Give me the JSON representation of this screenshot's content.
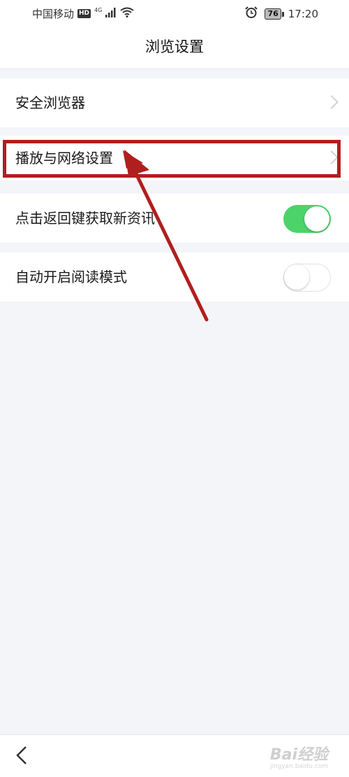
{
  "status_bar": {
    "carrier": "中国移动",
    "hd_badge": "HD",
    "network": "4G",
    "battery": "76",
    "time": "17:20",
    "icons": [
      "signal-icon",
      "wifi-icon",
      "alarm-icon",
      "battery-icon"
    ]
  },
  "header": {
    "title": "浏览设置"
  },
  "settings": {
    "items": [
      {
        "label": "安全浏览器",
        "type": "link"
      },
      {
        "label": "播放与网络设置",
        "type": "link"
      },
      {
        "label": "点击返回键获取新资讯",
        "type": "toggle",
        "enabled": true
      },
      {
        "label": "自动开启阅读模式",
        "type": "toggle",
        "enabled": false
      }
    ]
  },
  "annotation": {
    "color": "#b11e1e"
  },
  "toggle_on_color": "#4cd36a",
  "bottom_bar": {
    "back_icon": "chevron-left-icon",
    "watermark": "Bai经验",
    "watermark_sub": "jingyan.baidu.com"
  }
}
